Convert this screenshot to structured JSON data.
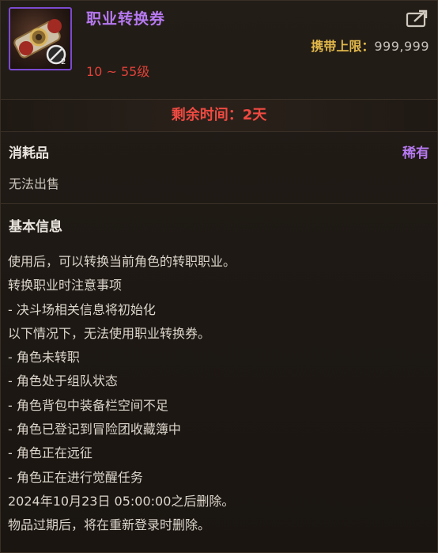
{
  "item": {
    "name": "职业转换券",
    "icon": "scroll-gear-icon",
    "level_range": "10 ~ 55级",
    "carry_limit_label": "携带上限：",
    "carry_limit_value": "999,999",
    "remaining_time": "剩余时间：2天",
    "type": "消耗品",
    "rarity": "稀有",
    "trade_status": "无法出售"
  },
  "section": {
    "title": "基本信息"
  },
  "description": [
    "使用后，可以转换当前角色的转职职业。",
    "转换职业时注意事项",
    "- 决斗场相关信息将初始化",
    "以下情况下，无法使用职业转换券。",
    "- 角色未转职",
    "- 角色处于组队状态",
    "- 角色背包中装备栏空间不足",
    "- 角色已登记到冒险团收藏簿中",
    "- 角色正在远征",
    "- 角色正在进行觉醒任务",
    "2024年10月23日 05:00:00之后删除。",
    "物品过期后，将在重新登录时删除。"
  ],
  "colors": {
    "rarity_purple": "#b679f0",
    "warning_red": "#ef4a41",
    "gold": "#e2b84a"
  }
}
